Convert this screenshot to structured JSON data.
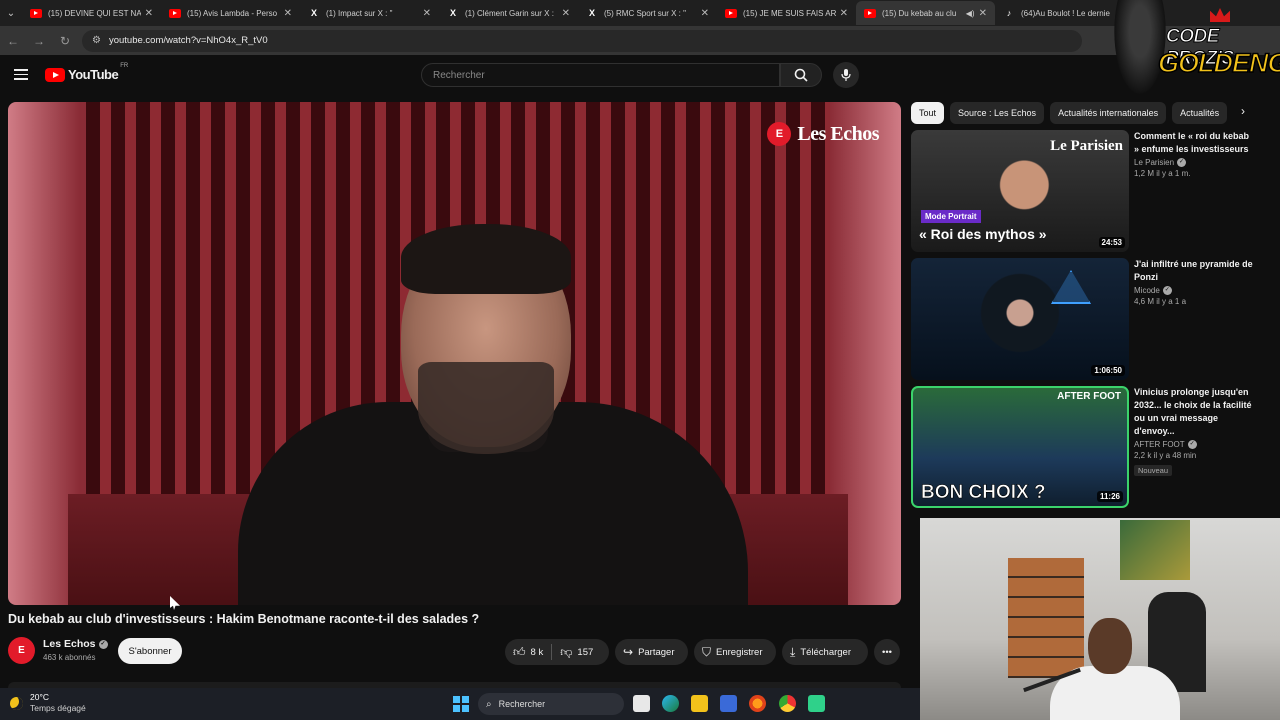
{
  "browser": {
    "tabs": [
      {
        "label": "(15) DEVINE QUI EST NAT",
        "icon": "youtube-icon",
        "active": false
      },
      {
        "label": "(15) Avis Lambda - Perso",
        "icon": "youtube-icon",
        "active": false
      },
      {
        "label": "(1) Impact sur X : \"",
        "icon": "x-icon",
        "active": false
      },
      {
        "label": "(1) Clément Garin sur X :",
        "icon": "x-icon",
        "active": false
      },
      {
        "label": "(5) RMC Sport sur X : \"",
        "icon": "x-icon",
        "active": false
      },
      {
        "label": "(15) JE ME SUIS FAIS ARN",
        "icon": "youtube-icon",
        "active": false
      },
      {
        "label": "(15) Du kebab au clu",
        "icon": "youtube-icon",
        "active": true
      },
      {
        "label": "(64)Au Boulot ! Le dernie",
        "icon": "tiktok-icon",
        "active": false
      }
    ],
    "url": "youtube.com/watch?v=NhO4x_R_tV0"
  },
  "youtube": {
    "logo_text": "YouTube",
    "country_code": "FR",
    "search_placeholder": "Rechercher"
  },
  "video": {
    "overlay_brand": "Les Echos",
    "title": "Du kebab au club d'investisseurs : Hakim Benotmane raconte-t-il des salades ?",
    "channel": "Les Echos",
    "subscribers": "463 k abonnés",
    "subscribe_label": "S'abonner",
    "likes": "8 k",
    "dislikes": "157",
    "share_label": "Partager",
    "save_label": "Enregistrer",
    "download_label": "Télécharger"
  },
  "chips": [
    "Tout",
    "Source : Les Echos",
    "Actualités internationales",
    "Actualités"
  ],
  "recommendations": [
    {
      "title": "Comment le « roi du kebab » enfume les investisseurs",
      "channel": "Le Parisien",
      "meta": "1,2 M  il y a 1 m.",
      "duration": "24:53",
      "thumb_brand": "Le Parisien",
      "thumb_tag": "Mode Portrait",
      "thumb_text": "« Roi des mythos »"
    },
    {
      "title": "J'ai infiltré une pyramide de Ponzi",
      "channel": "Micode",
      "meta": "4,6 M  il y a 1 a",
      "duration": "1:06:50"
    },
    {
      "title": "Vinicius prolonge jusqu'en 2032... le choix de la facilité ou un vrai message d'envoy...",
      "channel": "AFTER FOOT",
      "meta": "2,2 k  il y a 48 min",
      "badge": "Nouveau",
      "duration": "11:26",
      "thumb_tag": "AFTER FOOT",
      "thumb_text": "BON CHOIX ?"
    }
  ],
  "overlay": {
    "line1": "CODE PROZIS",
    "line2": "GOLDENG"
  },
  "taskbar": {
    "temperature": "20°C",
    "weather": "Temps dégagé",
    "search_label": "Rechercher"
  }
}
